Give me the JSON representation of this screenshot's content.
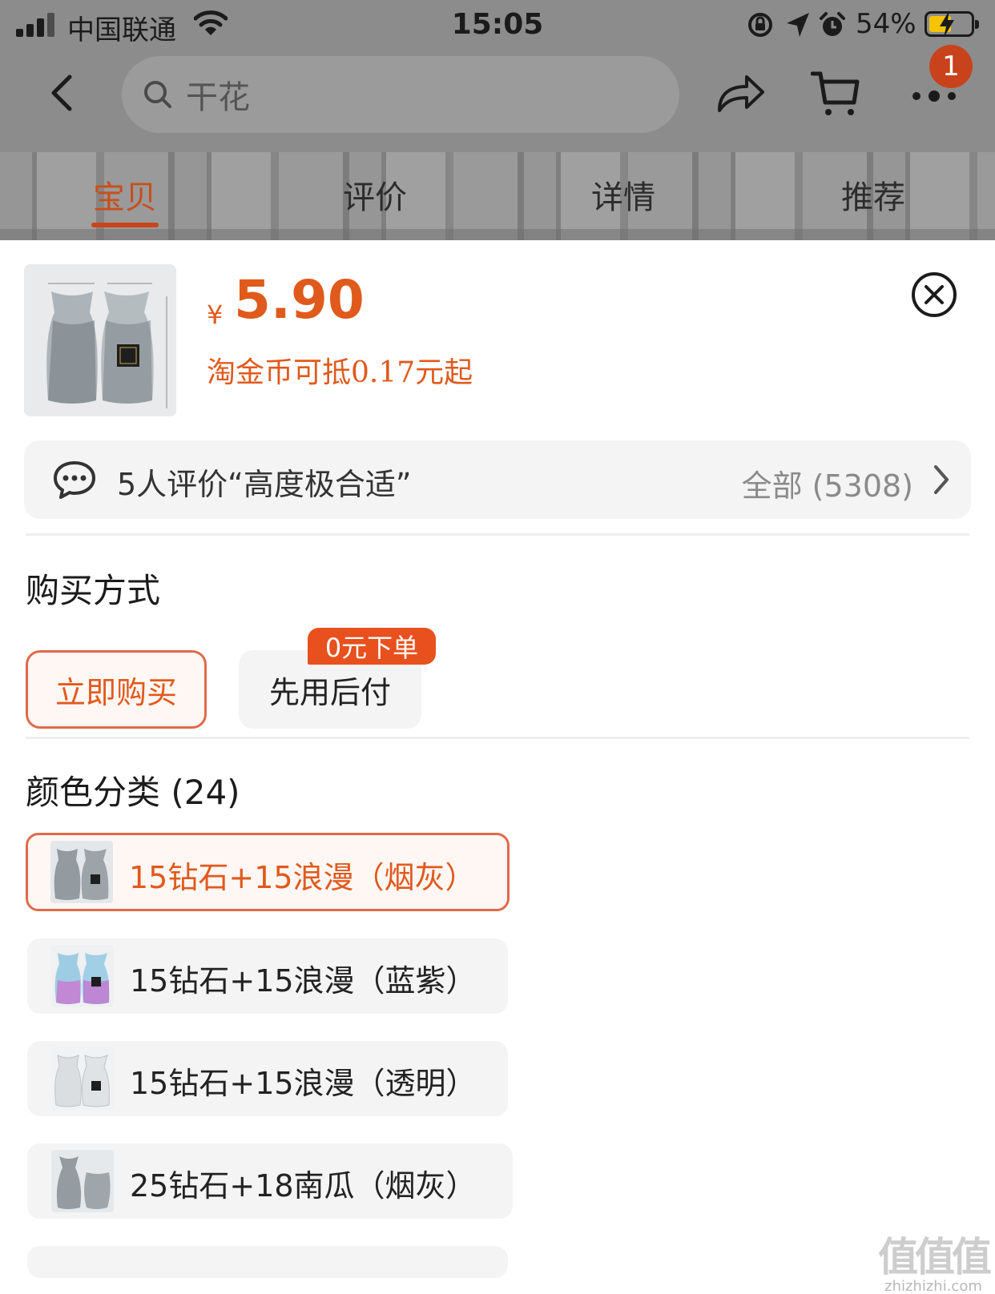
{
  "status_bar": {
    "carrier": "中国联通",
    "time": "15:05",
    "battery": "54%",
    "battery_level": 0.54
  },
  "nav": {
    "search_placeholder": "干花",
    "cart_badge": "1"
  },
  "tabs": [
    {
      "label": "宝贝",
      "active": true
    },
    {
      "label": "评价",
      "active": false
    },
    {
      "label": "详情",
      "active": false
    },
    {
      "label": "推荐",
      "active": false
    }
  ],
  "product": {
    "currency_symbol": "¥",
    "price": "5.90",
    "coin_deduct": "淘金币可抵0.17元起"
  },
  "review": {
    "summary": "5人评价“高度极合适”",
    "all_label": "全部 (5308)"
  },
  "purchase": {
    "title": "购买方式",
    "buy_now": "立即购买",
    "pay_later": "先用后付",
    "pay_later_tag": "0元下单"
  },
  "colors": {
    "title": "颜色分类 (24)",
    "options": [
      {
        "label": "15钻石+15浪漫（烟灰）",
        "selected": true
      },
      {
        "label": "15钻石+15浪漫（蓝紫）",
        "selected": false
      },
      {
        "label": "15钻石+15浪漫（透明）",
        "selected": false
      },
      {
        "label": "25钻石+18南瓜（烟灰）",
        "selected": false
      }
    ]
  },
  "watermark": {
    "glyph": "值值值",
    "url": "zhizhizhi.com"
  },
  "theme": {
    "accent": "#e05a1c",
    "selected_border": "#e06a4a",
    "badge_bg": "#c8421c",
    "chip_bg": "#f4f4f4"
  }
}
